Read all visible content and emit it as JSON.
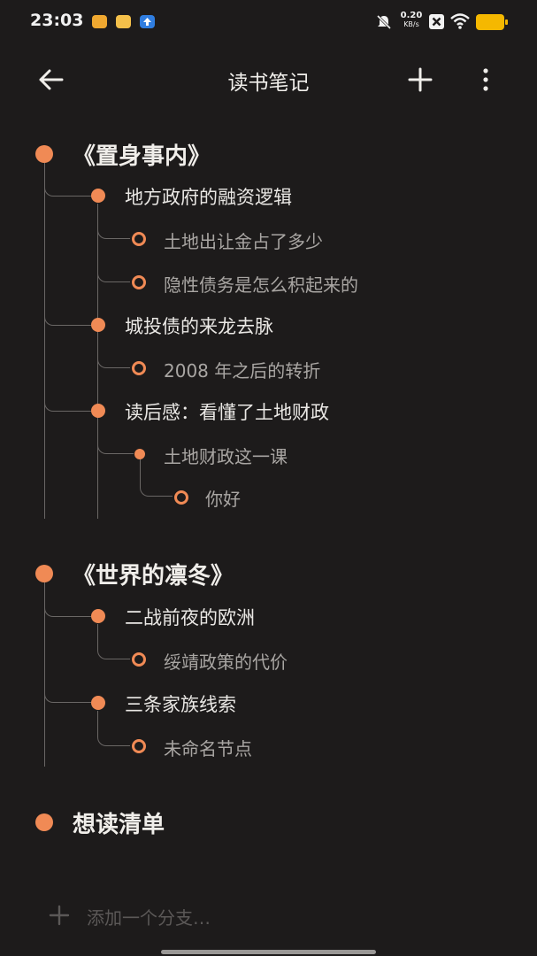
{
  "status_bar": {
    "time": "23:03",
    "speed_value": "0.20",
    "speed_unit": "KB/s",
    "icons": [
      "app-notification-icon",
      "app-notification-icon",
      "upload-icon",
      "mute-icon",
      "close-box-icon",
      "wifi-icon",
      "battery-icon"
    ]
  },
  "header": {
    "title": "读书笔记"
  },
  "tree": {
    "book1": {
      "title": "《置身事内》",
      "c1": {
        "label": "地方政府的融资逻辑",
        "s1": "土地出让金占了多少",
        "s2": "隐性债务是怎么积起来的"
      },
      "c2": {
        "label": "城投债的来龙去脉",
        "s1": "2008 年之后的转折"
      },
      "c3": {
        "label": "读后感：看懂了土地财政",
        "s1": "土地财政这一课",
        "s1a": "你好"
      }
    },
    "book2": {
      "title": "《世界的凛冬》",
      "c1": {
        "label": "二战前夜的欧洲",
        "s1": "绥靖政策的代价"
      },
      "c2": {
        "label": "三条家族线索",
        "s1": "未命名节点"
      }
    },
    "book3": {
      "title": "想读清单"
    }
  },
  "add_branch": {
    "placeholder": "添加一个分支…"
  },
  "colors": {
    "accent": "#f08a55",
    "background": "#1d1b1b"
  }
}
